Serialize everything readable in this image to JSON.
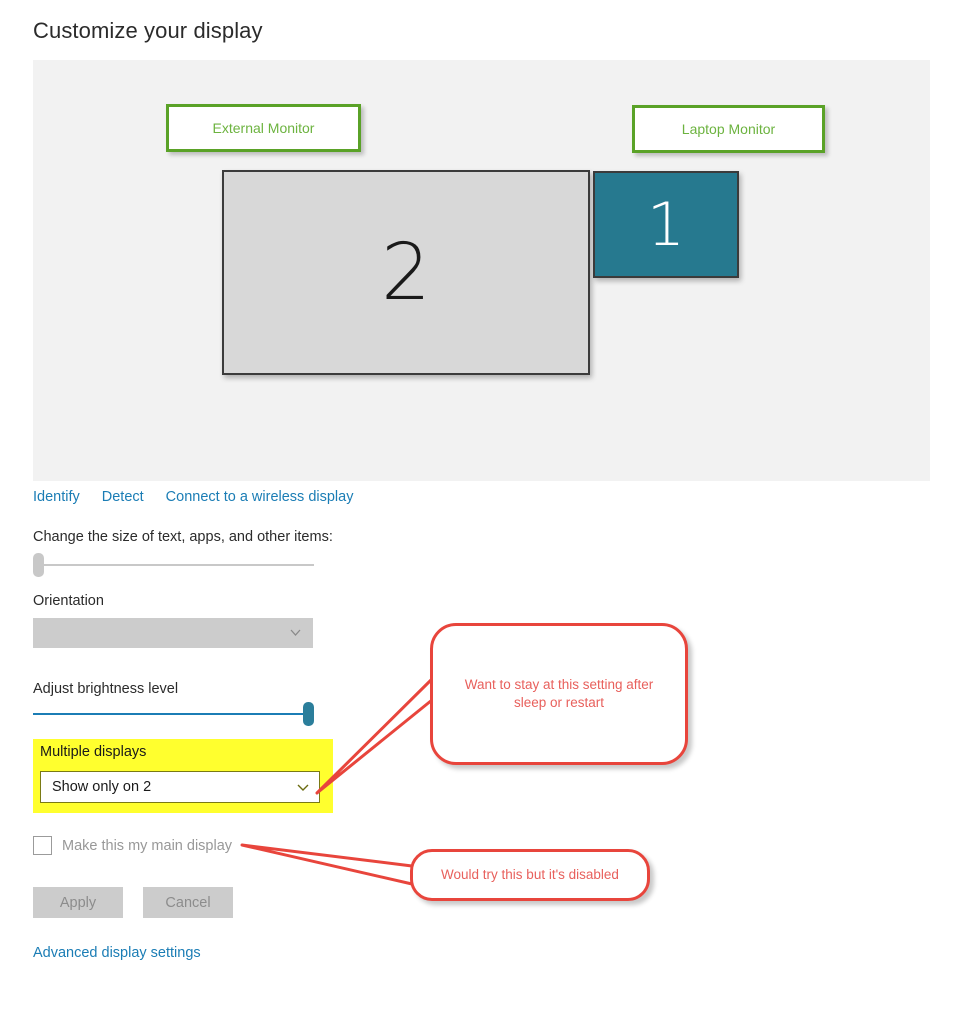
{
  "page": {
    "title": "Customize your display"
  },
  "preview": {
    "monitors": [
      {
        "number": "2",
        "role": "external",
        "color": "#d8d8d8"
      },
      {
        "number": "1",
        "role": "laptop",
        "color": "#26798f"
      }
    ],
    "annotation_labels": [
      {
        "text": "External Monitor",
        "color": "#6cb33f"
      },
      {
        "text": "Laptop Monitor",
        "color": "#6cb33f"
      }
    ]
  },
  "links": {
    "identify": "Identify",
    "detect": "Detect",
    "wireless": "Connect to a wireless display",
    "advanced": "Advanced display settings",
    "color": "#1b7db5"
  },
  "scaling": {
    "label": "Change the size of text, apps, and other items:",
    "slider_value": "0",
    "disabled": "true"
  },
  "orientation": {
    "label": "Orientation",
    "value": "",
    "chevron": "chevron-down-icon",
    "disabled": "true"
  },
  "brightness": {
    "label": "Adjust brightness level",
    "slider_value": "100"
  },
  "multiple_displays": {
    "label": "Multiple displays",
    "value": "Show only on 2",
    "chevron": "chevron-down-icon",
    "highlight_color": "#ffff2e"
  },
  "main_display": {
    "checkbox_label": "Make this my main display",
    "checked": "false",
    "disabled": "true"
  },
  "buttons": {
    "apply": "Apply",
    "cancel": "Cancel",
    "disabled": "true"
  },
  "callouts": [
    {
      "text": "Want to stay at this setting after sleep or restart",
      "color": "#e8453c",
      "points_to": "multiple-displays-dropdown"
    },
    {
      "text": "Would try this but it's disabled",
      "color": "#e8453c",
      "points_to": "make-main-display-checkbox"
    }
  ]
}
